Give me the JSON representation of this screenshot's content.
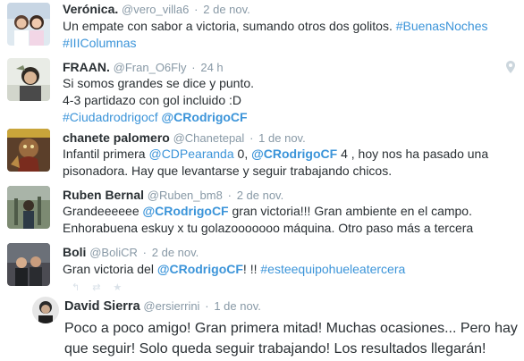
{
  "tweets": [
    {
      "name": "Verónica.",
      "handle": "@vero_villa6",
      "time": "2 de nov.",
      "lines": [
        [
          {
            "t": "Un empate con sabor a victoria,  sumando otros dos golitos. "
          },
          {
            "t": "#BuenasNoches",
            "link": true
          }
        ],
        [
          {
            "t": "#IIIColumnas",
            "link": true
          }
        ]
      ]
    },
    {
      "name": "FRAAN.",
      "handle": "@Fran_O6Fly",
      "time": "24 h",
      "lines": [
        [
          {
            "t": "Si somos grandes se dice y punto."
          }
        ],
        [
          {
            "t": "4-3 partidazo con gol incluido :D"
          }
        ],
        [
          {
            "t": "#Ciudadrodrigocf",
            "link": true
          },
          {
            "t": " "
          },
          {
            "t": "@CRodrigoCF",
            "link": true,
            "bold": true
          }
        ]
      ]
    },
    {
      "name": "chanete palomero",
      "handle": "@Chanetepal",
      "time": "1 de nov.",
      "lines": [
        [
          {
            "t": "Infantil primera "
          },
          {
            "t": "@CDPearanda",
            "link": true
          },
          {
            "t": "  0, "
          },
          {
            "t": "@CRodrigoCF",
            "link": true,
            "bold": true
          },
          {
            "t": " 4 , hoy nos ha pasado una"
          }
        ],
        [
          {
            "t": "pisonadora. Hay que levantarse y seguir trabajando chicos."
          }
        ]
      ]
    },
    {
      "name": "Ruben Bernal",
      "handle": "@Ruben_bm8",
      "time": "2 de nov.",
      "lines": [
        [
          {
            "t": "Grandeeeeee "
          },
          {
            "t": "@CRodrigoCF",
            "link": true,
            "bold": true
          },
          {
            "t": " gran victoria!!! Gran ambiente en el campo."
          }
        ],
        [
          {
            "t": "Enhorabuena eskuy x tu golazooooooo máquina. Otro paso más a tercera"
          }
        ]
      ]
    },
    {
      "name": "Boli",
      "handle": "@BoliCR",
      "time": "2 de nov.",
      "lines": [
        [
          {
            "t": "Gran victoria del "
          },
          {
            "t": "@CRodrigoCF",
            "link": true,
            "bold": true
          },
          {
            "t": "! !! "
          },
          {
            "t": "#esteequipohueleatercera",
            "link": true
          }
        ]
      ]
    },
    {
      "name": "David Sierra",
      "handle": "@ersierrini",
      "time": "1 de nov.",
      "lines": [
        [
          {
            "t": "Poco a poco amigo! Gran primera mitad! Muchas ocasiones... Pero hay"
          }
        ],
        [
          {
            "t": "que seguir! Solo queda seguir trabajando! Los resultados llegarán!"
          }
        ]
      ]
    }
  ],
  "icons": {
    "location": "map-pin-icon"
  }
}
